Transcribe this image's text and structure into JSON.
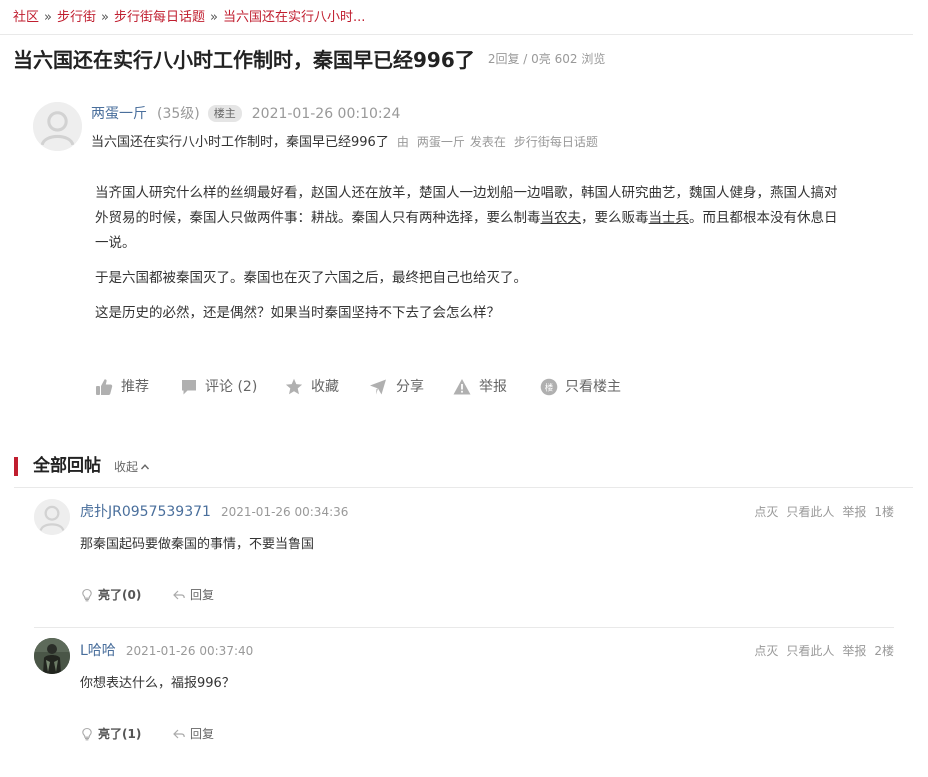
{
  "breadcrumb": {
    "items": [
      "社区",
      "步行街",
      "步行街每日话题",
      "当六国还在实行八小时..."
    ],
    "separator": "»"
  },
  "thread": {
    "title": "当六国还在实行八小时工作制时，秦国早已经996了",
    "stats": "2回复 / 0亮 602 浏览"
  },
  "op": {
    "username": "两蛋一斤",
    "level": "(35级)",
    "badge": "楼主",
    "time": "2021-01-26 00:10:24",
    "subtitle": {
      "title": "当六国还在实行八小时工作制时，秦国早已经996了",
      "by": "由",
      "author": "两蛋一斤",
      "posted_in": "发表在",
      "forum": "步行街每日话题"
    },
    "paragraph1": {
      "part1": "当齐国人研究什么样的丝绸最好看，赵国人还在放羊，楚国人一边划船一边唱歌，韩国人研究曲艺，魏国人健身，燕国人搞对外贸易的时候，秦国人只做两件事：耕战。秦国人只有两种选择，要么制毒",
      "link1": "当农夫",
      "part2": "，要么贩毒",
      "link2": "当士兵",
      "part3": "。而且都根本没有休息日一说。"
    },
    "paragraph2": "于是六国都被秦国灭了。秦国也在灭了六国之后，最终把自己也给灭了。",
    "paragraph3": "这是历史的必然，还是偶然？如果当时秦国坚持不下去了会怎么样？"
  },
  "actions": {
    "recommend": "推荐",
    "comment": "评论 (2)",
    "favorite": "收藏",
    "share": "分享",
    "report": "举报",
    "op_only": "只看楼主",
    "op_only_icon_char": "楼"
  },
  "replies_section": {
    "title": "全部回帖",
    "collapse": "收起"
  },
  "replies": [
    {
      "username": "虎扑JR0957539371",
      "time": "2021-01-26 00:34:36",
      "content": "那秦国起码要做秦国的事情，不要当鲁国",
      "dislike": "点灭",
      "only_this": "只看此人",
      "report": "举报",
      "floor": "1楼",
      "light": "亮了(0)",
      "reply": "回复"
    },
    {
      "username": "L哈哈",
      "time": "2021-01-26 00:37:40",
      "content": "你想表达什么，福报996？",
      "dislike": "点灭",
      "only_this": "只看此人",
      "report": "举报",
      "floor": "2楼",
      "light": "亮了(1)",
      "reply": "回复"
    }
  ],
  "colors": {
    "accent": "#c01e2f",
    "username": "#4a6f9c",
    "muted": "#999999",
    "icon": "#b0b0b0"
  }
}
